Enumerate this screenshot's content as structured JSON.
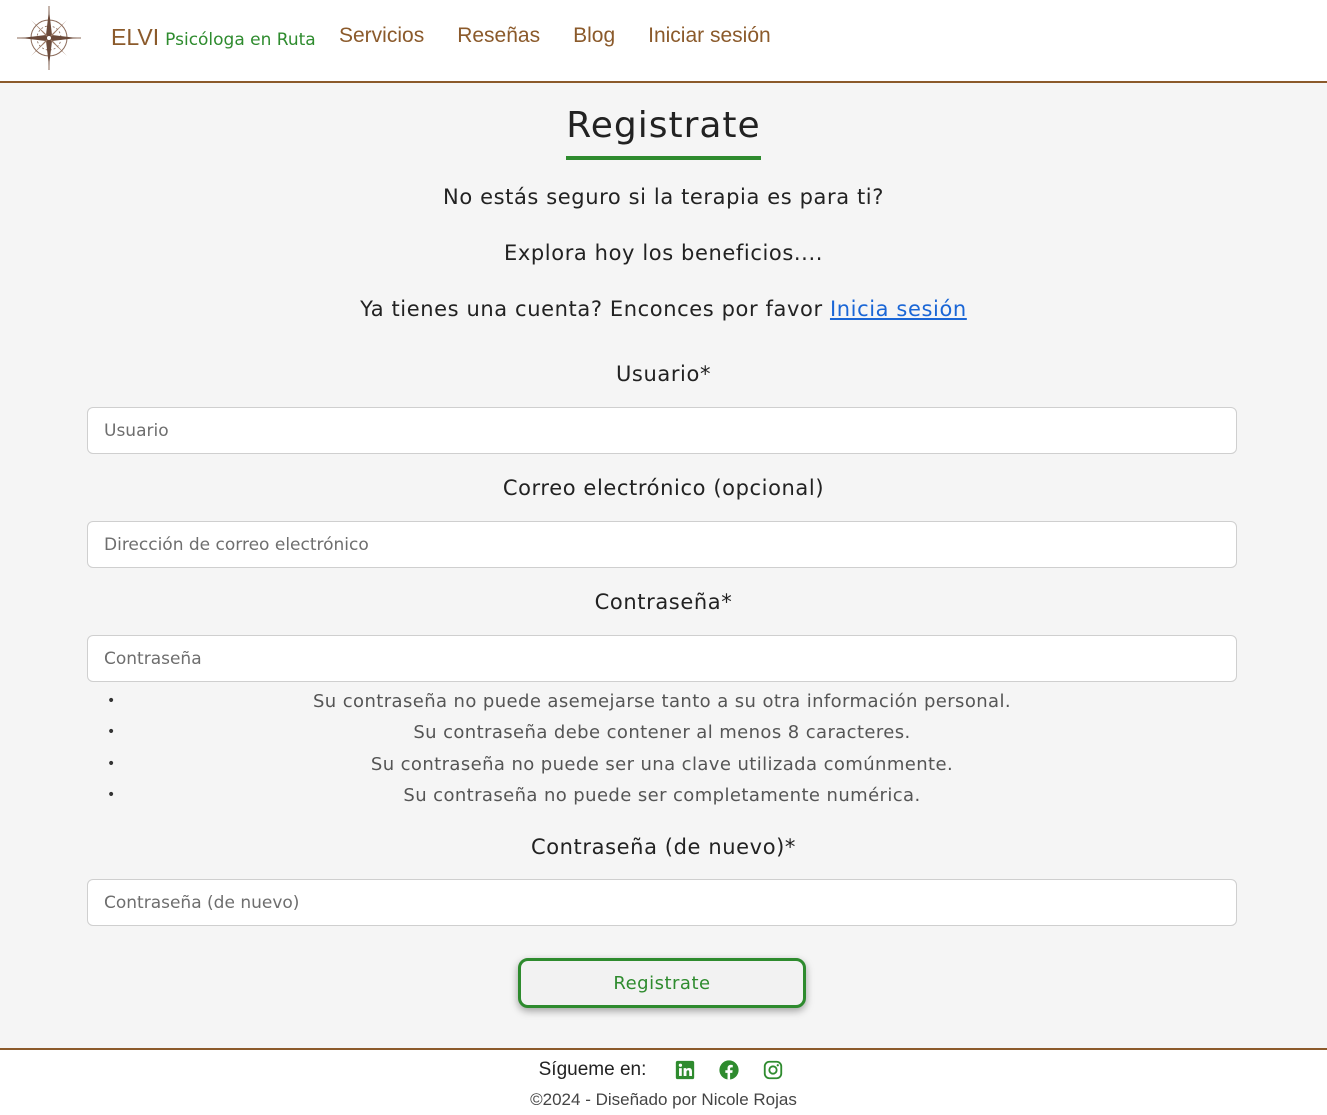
{
  "header": {
    "brand_main": "ELVI",
    "brand_sub": "Psicóloga en Ruta",
    "nav": [
      {
        "label": "Servicios"
      },
      {
        "label": "Reseñas"
      },
      {
        "label": "Blog"
      },
      {
        "label": "Iniciar sesión"
      }
    ],
    "logo_icon": "compass-rose-icon"
  },
  "main": {
    "title": "Registrate",
    "intro_1": "No estás seguro si la terapia es para ti?",
    "intro_2": "Explora hoy los beneficios....",
    "intro_3_prefix": "Ya tienes una cuenta? Enconces por favor ",
    "intro_3_link": "Inicia sesión",
    "fields": {
      "username": {
        "label": "Usuario*",
        "placeholder": "Usuario",
        "value": ""
      },
      "email": {
        "label": "Correo electrónico (opcional)",
        "placeholder": "Dirección de correo electrónico",
        "value": ""
      },
      "password": {
        "label": "Contraseña*",
        "placeholder": "Contraseña",
        "value": ""
      },
      "password2": {
        "label": "Contraseña (de nuevo)*",
        "placeholder": "Contraseña (de nuevo)",
        "value": ""
      }
    },
    "password_help": [
      "Su contraseña no puede asemejarse tanto a su otra información personal.",
      "Su contraseña debe contener al menos 8 caracteres.",
      "Su contraseña no puede ser una clave utilizada comúnmente.",
      "Su contraseña no puede ser completamente numérica."
    ],
    "submit_label": "Registrate"
  },
  "footer": {
    "follow_label": "Sígueme en:",
    "social": [
      "linkedin-icon",
      "facebook-icon",
      "instagram-icon"
    ],
    "copyright": "©2024 - Diseñado por Nicole Rojas"
  },
  "colors": {
    "brown": "#8b5a2b",
    "green": "#2e8b2e",
    "link_blue": "#1a66d6",
    "background": "#f5f5f5"
  }
}
